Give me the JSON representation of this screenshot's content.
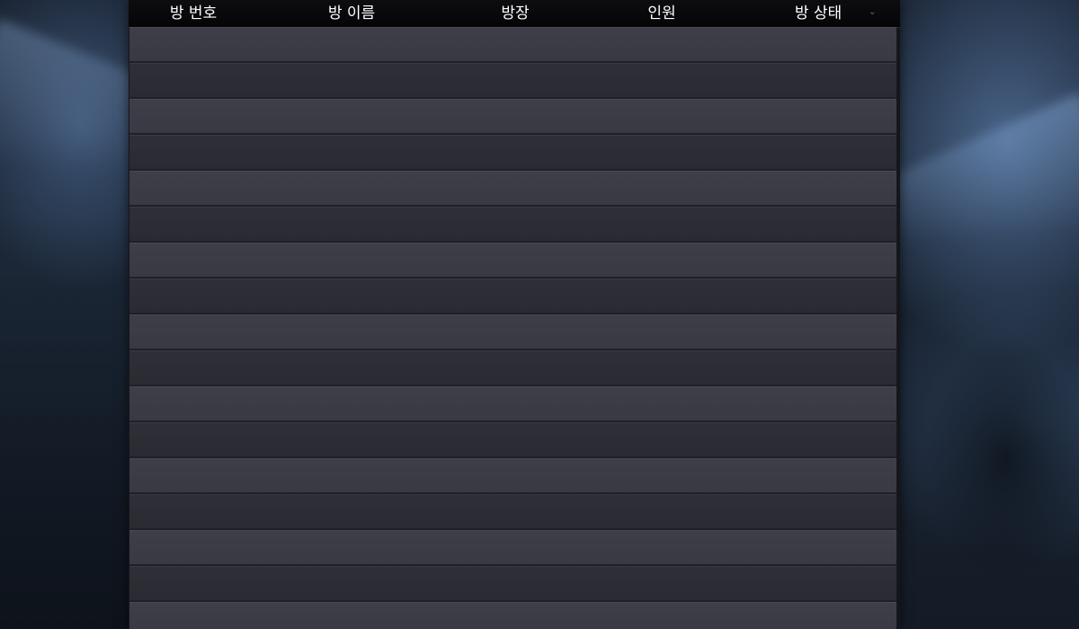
{
  "room_list": {
    "columns": {
      "room_number": "방 번호",
      "room_name": "방 이름",
      "host": "방장",
      "players": "인원",
      "room_status": "방 상태"
    },
    "sort_icon": "chevron-down-icon",
    "rows": [
      {},
      {},
      {},
      {},
      {},
      {},
      {},
      {},
      {},
      {},
      {},
      {},
      {},
      {},
      {},
      {},
      {}
    ]
  }
}
